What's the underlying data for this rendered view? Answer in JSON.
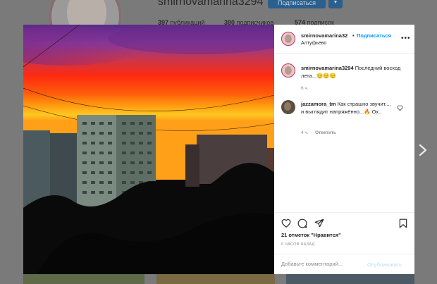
{
  "background_profile": {
    "username": "smirnovamarina3294",
    "follow_button": "Подписаться",
    "dropdown_icon": "chevron-down-icon",
    "stats": [
      {
        "count": "397",
        "label": "публикаций"
      },
      {
        "count": "380",
        "label": "подписчиков"
      },
      {
        "count": "574",
        "label": "подписок"
      }
    ]
  },
  "post": {
    "header": {
      "username": "smirnovamarina32",
      "separator": "•",
      "follow_label": "Подписаться",
      "location": "Алтуфьево"
    },
    "caption": {
      "username": "smirnovamarina3294",
      "text": "Последний восход лета...😔😔😔",
      "time": "6 ч."
    },
    "comments": [
      {
        "username": "jazzamora_tm",
        "text": "Как страшно звучит.... и выглядит напряжённо...🔥 Ох..",
        "time": "4 ч.",
        "reply_label": "Ответить"
      }
    ],
    "likes_text": "21 отметок \"Нравится\"",
    "time_ago": "6 ЧАСОВ НАЗАД",
    "comment_placeholder": "Добавьте комментарий...",
    "post_button": "Опубликовать"
  },
  "colors": {
    "link_blue": "#0095f6",
    "post_disabled": "#b2dffc",
    "avatar_ring": "#c22b63"
  }
}
